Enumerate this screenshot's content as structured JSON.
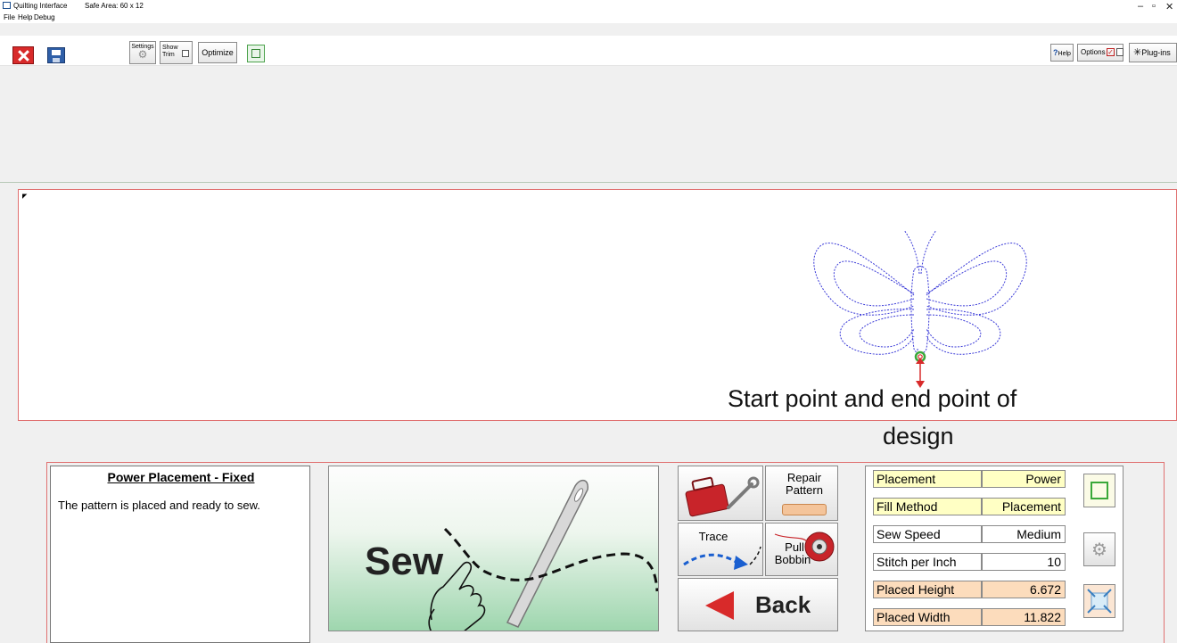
{
  "window": {
    "title": "Quilting Interface",
    "safe_area": "Safe Area: 60 x 12",
    "minimize": "–",
    "maximize": "▫",
    "close": "✕"
  },
  "menu": [
    "File",
    "Help",
    "Debug"
  ],
  "toolbar": {
    "settings_label": "Settings",
    "show_trim_label": "Show Trim",
    "optimize_label": "Optimize",
    "help_label": "Help",
    "options_label": "Options",
    "plugins_label": "Plug-ins",
    "options_checked": true
  },
  "annotation": {
    "line1": "Start point  and end point of",
    "line2": "design"
  },
  "status": {
    "title": "Power Placement - Fixed",
    "message": "The pattern is placed and ready to sew."
  },
  "buttons": {
    "sew": "Sew",
    "repair": "Repair Pattern",
    "trace": "Trace",
    "pull_bobbin_1": "Pull",
    "pull_bobbin_2": "Bobbin",
    "back": "Back"
  },
  "settings": [
    {
      "name": "Placement",
      "value": "Power",
      "color": "#ffffc4"
    },
    {
      "name": "Fill Method",
      "value": "Placement",
      "color": "#ffffc4"
    },
    {
      "name": "Sew Speed",
      "value": "Medium",
      "color": "#ffffff"
    },
    {
      "name": "Stitch per Inch",
      "value": "10",
      "color": "#ffffff"
    },
    {
      "name": "Placed Height",
      "value": "6.672",
      "color": "#fcdcbc"
    },
    {
      "name": "Placed Width",
      "value": "11.822",
      "color": "#fcdcbc"
    }
  ],
  "colors": {
    "accent_red": "#d82a2a",
    "border_red": "#e07070",
    "pattern_blue": "#3b3bd8",
    "sew_green": "#9ed6ae"
  }
}
